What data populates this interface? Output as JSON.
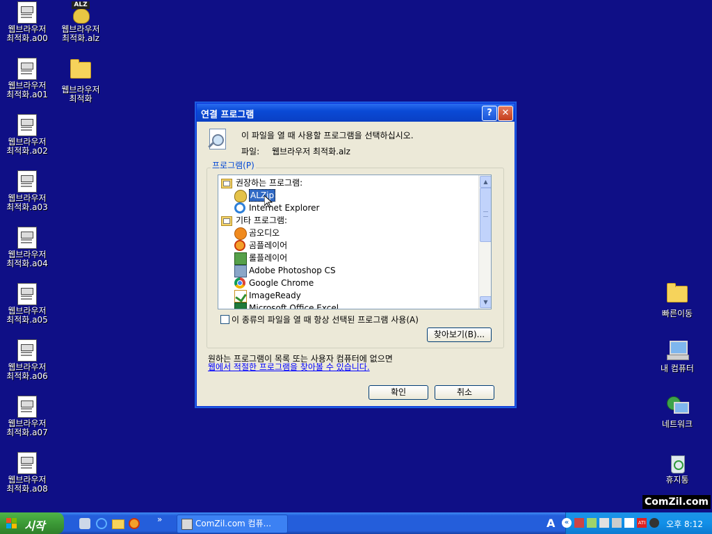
{
  "desktop": {
    "left_icons": [
      {
        "line1": "웹브라우저",
        "line2": "최적화.a00",
        "type": "doc"
      },
      {
        "line1": "웹브라우저",
        "line2": "최적화.a01",
        "type": "doc"
      },
      {
        "line1": "웹브라우저",
        "line2": "최적화.a02",
        "type": "doc"
      },
      {
        "line1": "웹브라우저",
        "line2": "최적화.a03",
        "type": "doc"
      },
      {
        "line1": "웹브라우저",
        "line2": "최적화.a04",
        "type": "doc"
      },
      {
        "line1": "웹브라우저",
        "line2": "최적화.a05",
        "type": "doc"
      },
      {
        "line1": "웹브라우저",
        "line2": "최적화.a06",
        "type": "doc"
      },
      {
        "line1": "웹브라우저",
        "line2": "최적화.a07",
        "type": "doc"
      },
      {
        "line1": "웹브라우저",
        "line2": "최적화.a08",
        "type": "doc"
      }
    ],
    "alz_icon": {
      "line1": "웹브라우저",
      "line2": "최적화.alz",
      "badge": "ALZ"
    },
    "folder_icon": {
      "line1": "웹브라우저",
      "line2": "최적화"
    },
    "right_icons": {
      "quick_move": "빠른이동",
      "my_computer": "내 컴퓨터",
      "network": "네트워크",
      "recycle_bin": "휴지통"
    },
    "background_color": "#0f0f86"
  },
  "dialog": {
    "title": "연결 프로그램",
    "help_glyph": "?",
    "close_glyph": "✕",
    "instruction": "이 파일을 열 때 사용할 프로그램을 선택하십시오.",
    "file_label": "파일:",
    "file_name": "웹브라우저 최적화.alz",
    "programs_group_label": "프로그램(P)",
    "list": [
      {
        "label": "권장하는 프로그램:",
        "icon": "category-icon",
        "kind": "header"
      },
      {
        "label": "ALZip",
        "icon": "alzip-icon",
        "kind": "item",
        "selected": true
      },
      {
        "label": "Internet Explorer",
        "icon": "ie-icon",
        "kind": "item"
      },
      {
        "label": "기타 프로그램:",
        "icon": "category-icon",
        "kind": "header"
      },
      {
        "label": "곰오디오",
        "icon": "gomaudio-icon",
        "kind": "item"
      },
      {
        "label": "곰플레이어",
        "icon": "gomplayer-icon",
        "kind": "item"
      },
      {
        "label": "롤플레이어",
        "icon": "rollplayer-icon",
        "kind": "item"
      },
      {
        "label": "Adobe Photoshop CS",
        "icon": "photoshop-icon",
        "kind": "item"
      },
      {
        "label": "Google Chrome",
        "icon": "chrome-icon",
        "kind": "item"
      },
      {
        "label": "ImageReady",
        "icon": "imageready-icon",
        "kind": "item"
      },
      {
        "label": "Microsoft Office Excel",
        "icon": "excel-icon",
        "kind": "item"
      }
    ],
    "always_use_label": "이 종류의 파일을 열 때 항상 선택된 프로그램 사용(A)",
    "always_use_checked": false,
    "browse_label": "찾아보기(B)...",
    "not_found_text": "원하는 프로그램이 목록 또는 사용자 컴퓨터에 없으면",
    "web_link": "웹에서 적절한 프로그램을 찾아볼 수 있습니다.",
    "ok_label": "확인",
    "cancel_label": "취소"
  },
  "watermark": "ComZil.com",
  "taskbar": {
    "start_label": "시작",
    "overflow_glyph": "»",
    "task_title": "ComZil.com 컴퓨...",
    "tray_arrow": "«",
    "tray_lang": "A",
    "clock": "오후 8:12"
  }
}
